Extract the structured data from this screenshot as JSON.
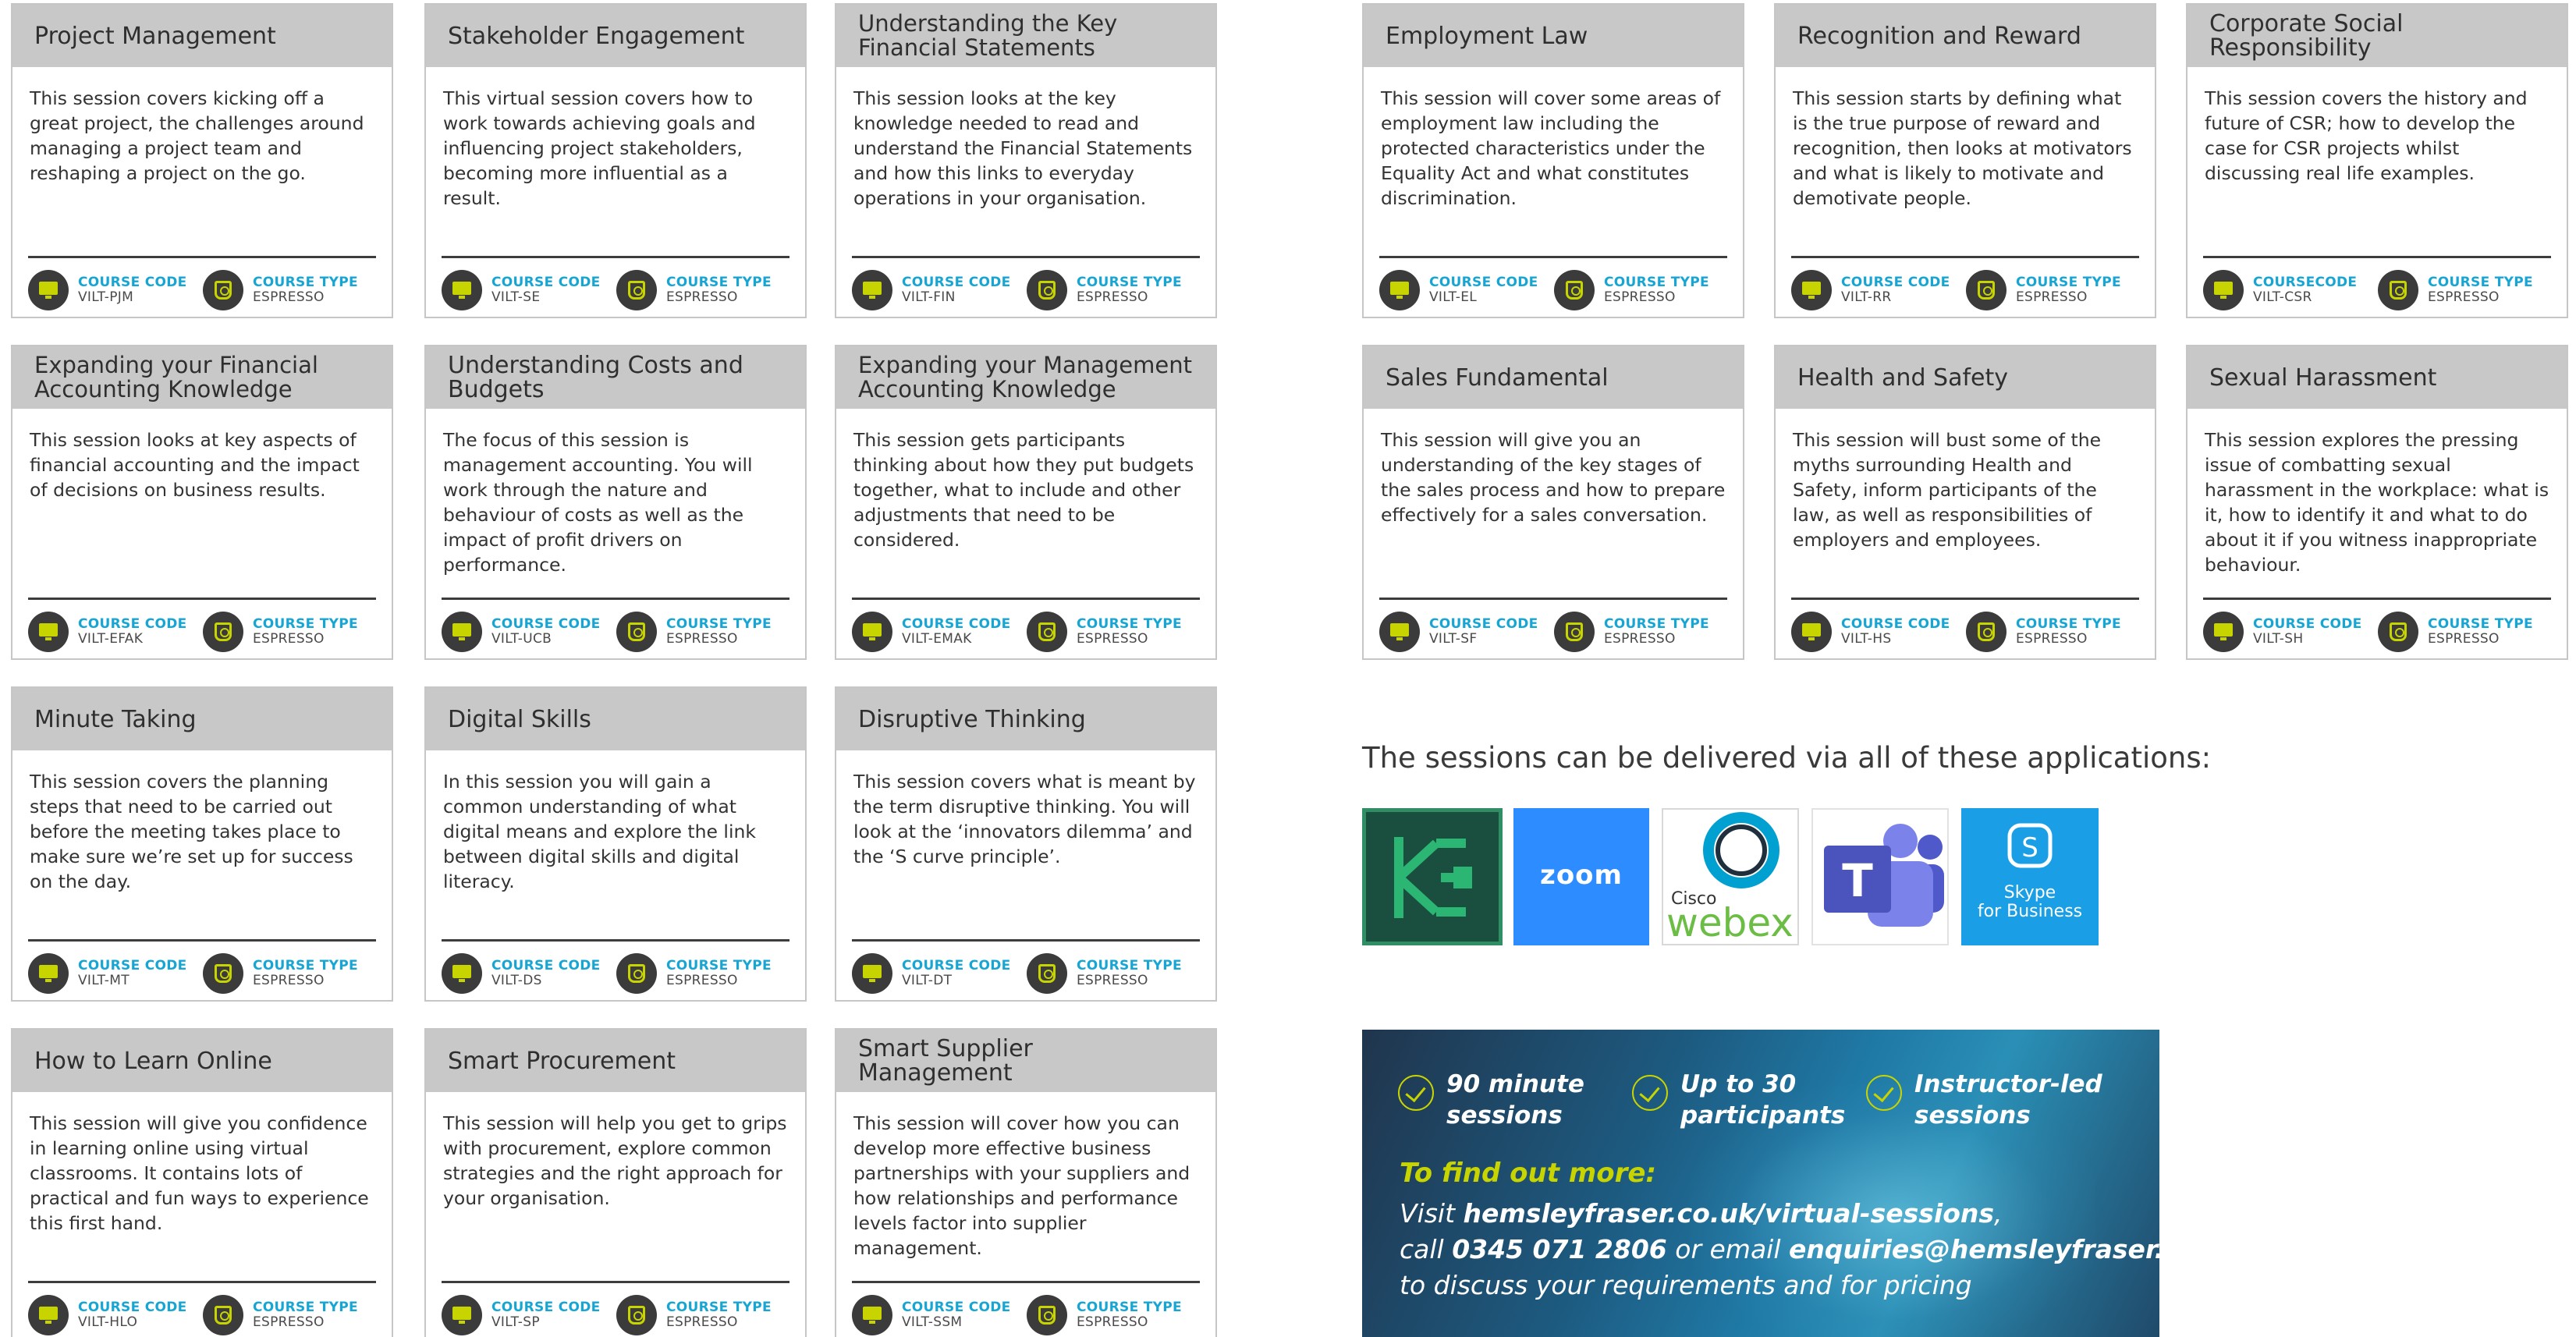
{
  "courses": [
    {
      "title_lines": [
        "Project Management"
      ],
      "description": "This session covers kicking off a great project, the challenges around managing a project team and reshaping a project on the go.",
      "code": "VILT-PJM",
      "type": "ESPRESSO",
      "code_label": "COURSE CODE",
      "type_label": "COURSE TYPE"
    },
    {
      "title_lines": [
        "Stakeholder Engagement"
      ],
      "description": "This virtual session covers how to work towards achieving goals and influencing project stakeholders, becoming more influential as a result.",
      "code": "VILT-SE",
      "type": "ESPRESSO",
      "code_label": "COURSE CODE",
      "type_label": "COURSE TYPE"
    },
    {
      "title_lines": [
        "Understanding the Key",
        "Financial Statements"
      ],
      "description": "This session looks at the key knowledge needed to read and understand the Financial Statements and how this links to everyday operations in your organisation.",
      "code": "VILT-FIN",
      "type": "ESPRESSO",
      "code_label": "COURSE CODE",
      "type_label": "COURSE TYPE"
    },
    {
      "title_lines": [
        "Employment Law"
      ],
      "description": "This session will cover some areas of employment law including the protected characteristics under the Equality Act and what constitutes discrimination.",
      "code": "VILT-EL",
      "type": "ESPRESSO",
      "code_label": "COURSE CODE",
      "type_label": "COURSE TYPE"
    },
    {
      "title_lines": [
        "Recognition and Reward"
      ],
      "description": "This session starts by defining what is the true purpose of reward and recognition, then looks at motivators and what is likely to motivate and demotivate people.",
      "code": "VILT-RR",
      "type": "ESPRESSO",
      "code_label": "COURSE CODE",
      "type_label": "COURSE TYPE"
    },
    {
      "title_lines": [
        "Corporate Social Responsibility"
      ],
      "description": "This session covers the history and future of CSR; how to develop the case for CSR projects whilst discussing real life examples.",
      "code": "VILT-CSR",
      "type": "ESPRESSO",
      "code_label": "COURSECODE",
      "type_label": "COURSE TYPE"
    },
    {
      "title_lines": [
        "Expanding your Financial",
        "Accounting Knowledge"
      ],
      "description": "This session looks at key aspects of financial accounting and the impact of decisions on business results.",
      "code": "VILT-EFAK",
      "type": "ESPRESSO",
      "code_label": "COURSE CODE",
      "type_label": "COURSE TYPE"
    },
    {
      "title_lines": [
        "Understanding Costs and Budgets"
      ],
      "description": "The focus of this session is management accounting. You will work through the nature and behaviour of costs as well as the impact of profit drivers on performance.",
      "code": "VILT-UCB",
      "type": "ESPRESSO",
      "code_label": "COURSE CODE",
      "type_label": "COURSE TYPE"
    },
    {
      "title_lines": [
        "Expanding your Management",
        "Accounting Knowledge"
      ],
      "description": "This session gets participants thinking about how they put budgets together, what to include and other adjustments that need to be considered.",
      "code": "VILT-EMAK",
      "type": "ESPRESSO",
      "code_label": "COURSE CODE",
      "type_label": "COURSE TYPE"
    },
    {
      "title_lines": [
        "Sales Fundamental"
      ],
      "description": "This session will give you an understanding of the key stages of the sales process and how to prepare effectively for a sales conversation.",
      "code": "VILT-SF",
      "type": "ESPRESSO",
      "code_label": "COURSE CODE",
      "type_label": "COURSE TYPE"
    },
    {
      "title_lines": [
        "Health and Safety"
      ],
      "description": "This session will bust some of the myths surrounding Health and Safety, inform participants of the law, as well as responsibilities of employers and employees.",
      "code": "VILT-HS",
      "type": "ESPRESSO",
      "code_label": "COURSE CODE",
      "type_label": "COURSE TYPE"
    },
    {
      "title_lines": [
        "Sexual Harassment"
      ],
      "description": "This session explores the pressing issue of combatting sexual harassment in the workplace: what is it, how to identify it and what to do about it if you witness inappropriate behaviour.",
      "code": "VILT-SH",
      "type": "ESPRESSO",
      "code_label": "COURSE CODE",
      "type_label": "COURSE TYPE"
    },
    {
      "title_lines": [
        "Minute Taking"
      ],
      "description": "This session covers the planning steps that need to be carried out before the meeting takes place to make sure we’re set up for success on the day.",
      "code": "VILT-MT",
      "type": "ESPRESSO",
      "code_label": "COURSE CODE",
      "type_label": "COURSE TYPE"
    },
    {
      "title_lines": [
        "Digital Skills"
      ],
      "description": "In this session you will gain a common understanding of what digital means and explore the link between digital skills and digital literacy.",
      "code": "VILT-DS",
      "type": "ESPRESSO",
      "code_label": "COURSE CODE",
      "type_label": "COURSE TYPE"
    },
    {
      "title_lines": [
        "Disruptive Thinking"
      ],
      "description": "This session covers what is meant by the term disruptive thinking. You will look at the ‘innovators dilemma’ and the ‘S curve principle’.",
      "code": "VILT-DT",
      "type": "ESPRESSO",
      "code_label": "COURSE CODE",
      "type_label": "COURSE TYPE"
    },
    {
      "title_lines": [
        "How to Learn Online"
      ],
      "description": "This session will give you confidence in learning online using virtual classrooms. It contains lots of practical and fun ways to experience this first hand.",
      "code": "VILT-HLO",
      "type": "ESPRESSO",
      "code_label": "COURSE CODE",
      "type_label": "COURSE TYPE"
    },
    {
      "title_lines": [
        "Smart Procurement"
      ],
      "description": "This session will help you get to grips with procurement, explore common strategies and the right approach for your organisation.",
      "code": "VILT-SP",
      "type": "ESPRESSO",
      "code_label": "COURSE CODE",
      "type_label": "COURSE TYPE"
    },
    {
      "title_lines": [
        "Smart Supplier Management"
      ],
      "description": "This session will cover how you can develop more effective business partnerships with your suppliers and how relationships and performance levels factor into supplier management.",
      "code": "VILT-SSM",
      "type": "ESPRESSO",
      "code_label": "COURSE CODE",
      "type_label": "COURSE TYPE"
    }
  ],
  "apps": {
    "heading": "The sessions can be delivered via all of these applications:",
    "tiles": [
      {
        "name": "adobe-connect-logo",
        "icon": "connect-logo-icon"
      },
      {
        "name": "zoom-logo",
        "word": "zoom"
      },
      {
        "name": "webex-logo",
        "line1": "Cisco",
        "line2": "webex"
      },
      {
        "name": "teams-logo",
        "letter": "T"
      },
      {
        "name": "skype-logo",
        "letter": "S",
        "line1": "Skype",
        "line2": "for Business"
      }
    ]
  },
  "promo": {
    "features": [
      {
        "line1": "90 minute",
        "line2": "sessions"
      },
      {
        "line1": "Up to 30",
        "line2": "participants"
      },
      {
        "line1": "Instructor-led",
        "line2": "sessions"
      }
    ],
    "cta": "To find out more:",
    "visit_prefix": "Visit ",
    "website": "hemsleyfraser.co.uk/virtual-sessions",
    "visit_suffix": ",",
    "call_prefix": "call ",
    "phone": "0345 071 2806",
    "email_prefix": " or email ",
    "email": "enquiries@hemsleyfraser.co.uk",
    "closing": "to discuss your requirements and for pricing"
  },
  "colors": {
    "header_grey": "#c8c8c8",
    "label_blue": "#17a6d4",
    "icon_lime": "#c8d400",
    "icon_dark": "#3b3b3b"
  }
}
